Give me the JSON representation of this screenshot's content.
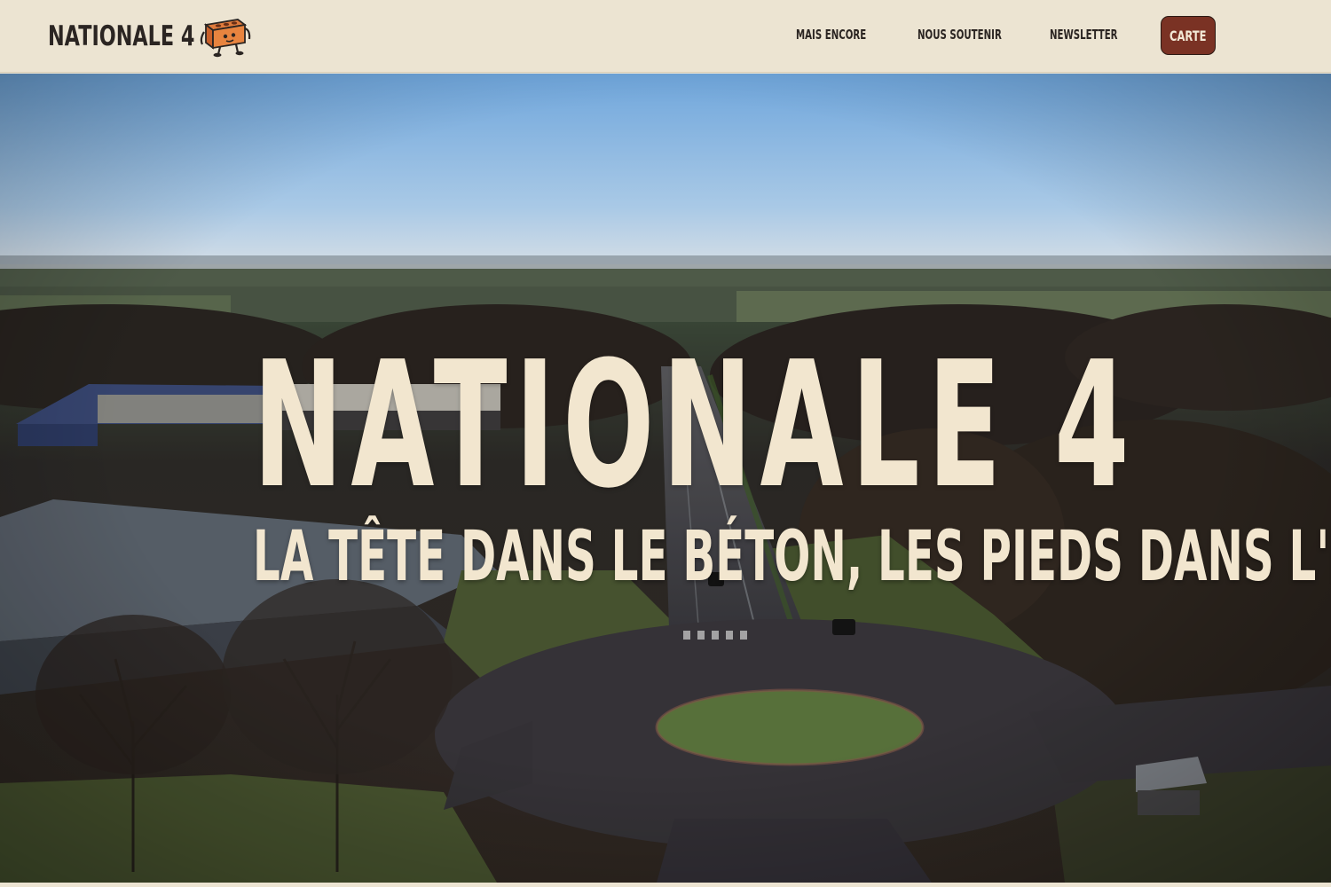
{
  "header": {
    "brand": "NATIONALE 4",
    "brand_mascot_icon": "brick-mascot-icon",
    "nav": [
      {
        "label": "MAIS ENCORE"
      },
      {
        "label": "NOUS SOUTENIR"
      },
      {
        "label": "NEWSLETTER"
      }
    ],
    "cta_label": "CARTE"
  },
  "hero": {
    "title": "NATIONALE 4",
    "subtitle": "LA TÊTE DANS LE BÉTON, LES PIEDS DANS L'EAU",
    "background": "aerial-road-roundabout-photo"
  },
  "colors": {
    "page_bg": "#ece4d2",
    "text_dark": "#2b2522",
    "cta_bg": "#7a3224",
    "hero_text": "#f2e6cf"
  }
}
